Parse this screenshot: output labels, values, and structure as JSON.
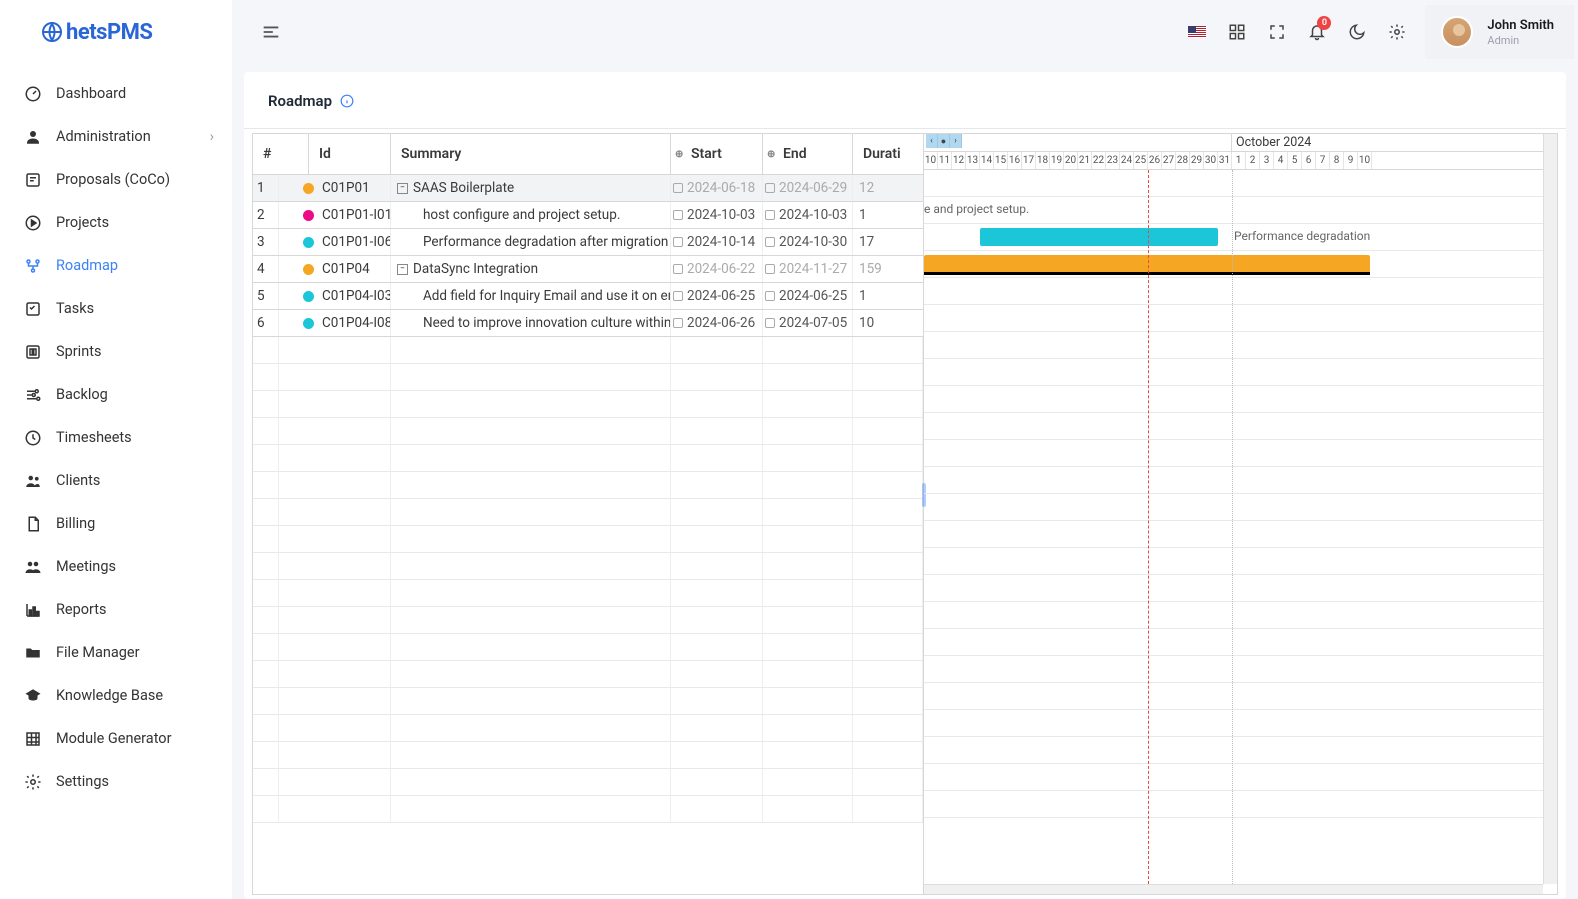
{
  "logo": "hetsPMS",
  "user": {
    "name": "John Smith",
    "role": "Admin"
  },
  "notifications_count": "0",
  "sidebar": {
    "items": [
      {
        "label": "Dashboard"
      },
      {
        "label": "Administration"
      },
      {
        "label": "Proposals (CoCo)"
      },
      {
        "label": "Projects"
      },
      {
        "label": "Roadmap"
      },
      {
        "label": "Tasks"
      },
      {
        "label": "Sprints"
      },
      {
        "label": "Backlog"
      },
      {
        "label": "Timesheets"
      },
      {
        "label": "Clients"
      },
      {
        "label": "Billing"
      },
      {
        "label": "Meetings"
      },
      {
        "label": "Reports"
      },
      {
        "label": "File Manager"
      },
      {
        "label": "Knowledge Base"
      },
      {
        "label": "Module Generator"
      },
      {
        "label": "Settings"
      }
    ]
  },
  "page_title": "Roadmap",
  "columns": {
    "num": "#",
    "id": "Id",
    "summary": "Summary",
    "start": "Start",
    "end": "End",
    "duration": "Durati"
  },
  "rows": [
    {
      "n": "1",
      "id": "C01P01",
      "summary": "SAAS Boilerplate",
      "start": "2024-06-18",
      "end": "2024-06-29",
      "dur": "12",
      "color": "orange",
      "parent": true,
      "muted": true
    },
    {
      "n": "2",
      "id": "C01P01-I01",
      "summary": "host configure and project setup.",
      "start": "2024-10-03",
      "end": "2024-10-03",
      "dur": "1",
      "color": "pink",
      "muted": false
    },
    {
      "n": "3",
      "id": "C01P01-I06",
      "summary": "Performance degradation after migration du",
      "start": "2024-10-14",
      "end": "2024-10-30",
      "dur": "17",
      "color": "cyan",
      "muted": false
    },
    {
      "n": "4",
      "id": "C01P04",
      "summary": "DataSync Integration",
      "start": "2024-06-22",
      "end": "2024-11-27",
      "dur": "159",
      "color": "orange",
      "parent": true,
      "muted": true
    },
    {
      "n": "5",
      "id": "C01P04-I03",
      "summary": "Add field for Inquiry Email and use it on em",
      "start": "2024-06-25",
      "end": "2024-06-25",
      "dur": "1",
      "color": "cyan",
      "muted": false
    },
    {
      "n": "6",
      "id": "C01P04-I08",
      "summary": "Need to improve innovation culture within th",
      "start": "2024-06-26",
      "end": "2024-07-05",
      "dur": "10",
      "color": "cyan",
      "muted": false
    }
  ],
  "timeline": {
    "month": "October 2024",
    "days_left": [
      "10",
      "11",
      "12",
      "13",
      "14",
      "15",
      "16",
      "17",
      "18",
      "19",
      "20",
      "21",
      "22",
      "23",
      "24",
      "25",
      "26",
      "27",
      "28",
      "29",
      "30",
      "31"
    ],
    "days_right": [
      "1",
      "2",
      "3",
      "4",
      "5",
      "6",
      "7",
      "8",
      "9",
      "10"
    ]
  },
  "bar_labels": {
    "row2": "e and project setup.",
    "row3": "Performance degradation"
  }
}
